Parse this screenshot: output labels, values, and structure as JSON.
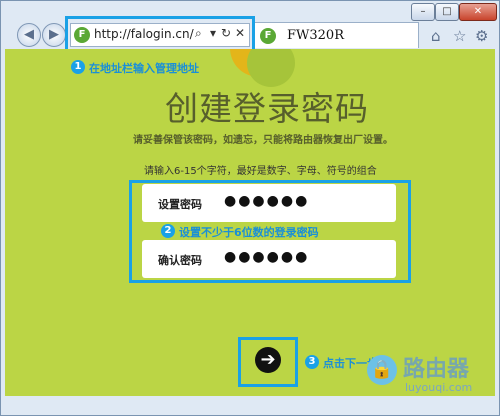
{
  "browser": {
    "address_url": "http://falogin.cn/",
    "tab_title": "FW320R",
    "favicon_letter": "F"
  },
  "window_controls": {
    "minimize": "–",
    "maximize": "□",
    "close": "✕"
  },
  "icons": {
    "search": "search-icon",
    "refresh": "refresh-icon",
    "close": "close-icon",
    "home": "home-icon",
    "favorites": "star-icon",
    "settings": "gear-icon"
  },
  "page": {
    "headline": "创建登录密码",
    "note": "请妥善保管该密码，如遗忘，只能将路由器恢复出厂设置。",
    "hint": "请输入6-15个字符，最好是数字、字母、符号的组合",
    "fields": [
      {
        "label": "设置密码",
        "value": "●●●●●●"
      },
      {
        "label": "确认密码",
        "value": "●●●●●●"
      }
    ],
    "next_arrow": "➔"
  },
  "steps": [
    {
      "num": "1",
      "text": "在地址栏输入管理地址"
    },
    {
      "num": "2",
      "text": "设置不少于6位数的登录密码"
    },
    {
      "num": "3",
      "text": "点击下一步"
    }
  ],
  "watermark": {
    "brand": "路由器",
    "site": "luyouqi.com"
  },
  "colors": {
    "callout": "#1aa1e6",
    "page_bg": "#bbd545"
  }
}
